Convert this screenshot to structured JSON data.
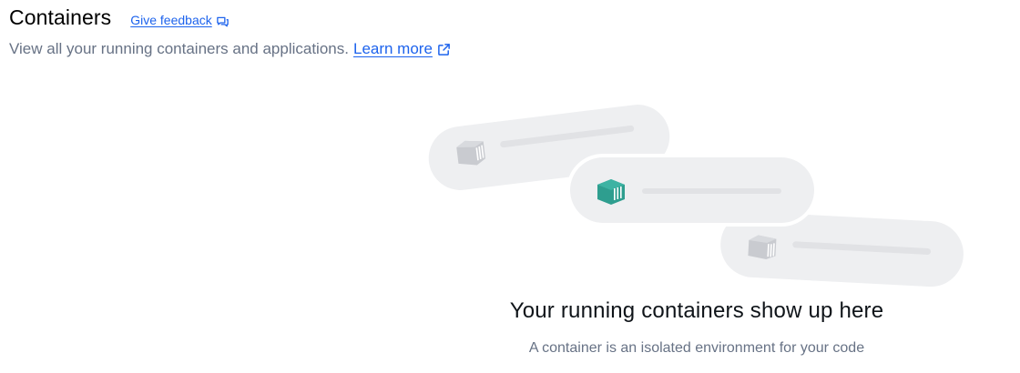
{
  "header": {
    "title": "Containers",
    "feedback_label": "Give feedback"
  },
  "subtitle": {
    "text": "View all your running containers and applications.",
    "learn_more_label": "Learn more"
  },
  "empty_state": {
    "title": "Your running containers show up here",
    "description": "A container is an isolated environment for your code"
  },
  "icons": {
    "feedback": "chat-bubbles-icon",
    "learn_more": "external-link-icon",
    "container": "container-icon"
  },
  "colors": {
    "link": "#1d63ed",
    "muted_text": "#677285",
    "accent_container": "#2e9e8f",
    "placeholder_pill": "#eeeff1",
    "placeholder_line": "#e1e2e5",
    "inactive_container": "#c9cbd0"
  }
}
